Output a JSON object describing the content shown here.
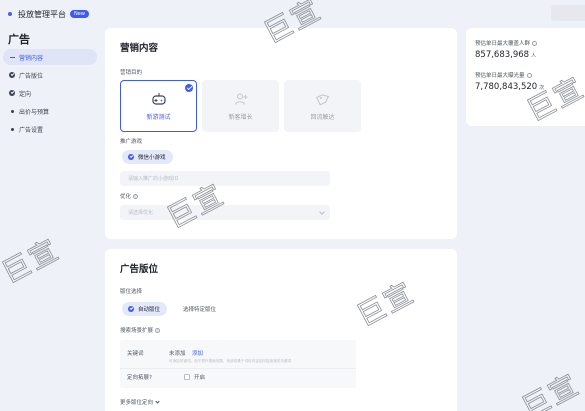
{
  "header": {
    "app_title": "投放管理平台",
    "badge": "New"
  },
  "sidebar": {
    "title": "广告",
    "items": [
      {
        "label": "营销内容",
        "state": "active"
      },
      {
        "label": "广告版位",
        "state": "done"
      },
      {
        "label": "定向",
        "state": "done"
      },
      {
        "label": "出价与预算",
        "state": "pending"
      },
      {
        "label": "广告设置",
        "state": "pending"
      }
    ]
  },
  "marketing": {
    "title": "营销内容",
    "goal_label": "营销目的",
    "goals": [
      {
        "label": "新游测试",
        "icon": "gamepad-icon",
        "selected": true
      },
      {
        "label": "新客增长",
        "icon": "user-add-icon",
        "selected": false
      },
      {
        "label": "回流触达",
        "icon": "tag-icon",
        "selected": false
      }
    ],
    "promo_label": "推广游戏",
    "promo_option": "微信小游戏",
    "promo_placeholder": "请输入推广的小游戏ID",
    "optimize_label": "优化",
    "optimize_placeholder": "请选择优化"
  },
  "placement": {
    "title": "广告版位",
    "select_label": "版位选择",
    "option_auto": "自动版位",
    "option_manual": "选择特定版位",
    "search_label": "搜索场景扩展",
    "keyword_label": "关键词",
    "keyword_value": "未添加",
    "keyword_add": "添加",
    "keyword_hint": "可添加关键词，用于提升搜索效果，系统将基于词包内容定向投放相关关键词",
    "expand_label": "定向拓展",
    "expand_open": "开启",
    "more_settings": "更多版位定向"
  },
  "estimate": {
    "max_people_label": "预估单日最大覆盖人群",
    "max_people_value": "857,683,968",
    "max_people_unit": "人",
    "max_exposure_label": "预估单日最大曝光量",
    "max_exposure_value": "7,780,843,520",
    "max_exposure_unit": "次"
  },
  "watermark": {
    "text": "巨宣"
  },
  "colors": {
    "accent": "#3d5af1",
    "page_bg": "#eef1f7"
  }
}
